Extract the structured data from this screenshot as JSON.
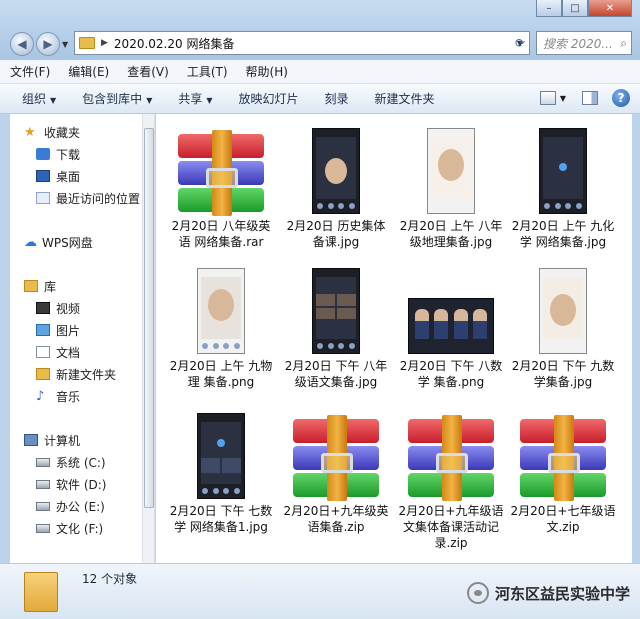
{
  "window": {
    "address_path": "2020.02.20 网络集备",
    "search_placeholder": "搜索 2020...",
    "controls": {
      "minimize": "–",
      "maximize": "□",
      "close": "✕"
    }
  },
  "menu": [
    "文件(F)",
    "编辑(E)",
    "查看(V)",
    "工具(T)",
    "帮助(H)"
  ],
  "commands": [
    {
      "label": "组织",
      "has_dropdown": true
    },
    {
      "label": "包含到库中",
      "has_dropdown": true
    },
    {
      "label": "共享",
      "has_dropdown": true
    },
    {
      "label": "放映幻灯片",
      "has_dropdown": false
    },
    {
      "label": "刻录",
      "has_dropdown": false
    },
    {
      "label": "新建文件夹",
      "has_dropdown": false
    }
  ],
  "nav": {
    "favorites": {
      "label": "收藏夹",
      "items": [
        "下载",
        "桌面",
        "最近访问的位置"
      ]
    },
    "wps": "WPS网盘",
    "library": {
      "label": "库",
      "items": [
        "视频",
        "图片",
        "文档",
        "新建文件夹",
        "音乐"
      ]
    },
    "computer": {
      "label": "计算机",
      "items": [
        "系统 (C:)",
        "软件 (D:)",
        "办公 (E:)",
        "文化 (F:)"
      ]
    }
  },
  "files": [
    {
      "name": "2月20日 八年级英语 网络集备.rar",
      "type": "rar"
    },
    {
      "name": "2月20日 历史集体备课.jpg",
      "type": "phone-dark"
    },
    {
      "name": "2月20日 上午 八年级地理集备.jpg",
      "type": "phone-light"
    },
    {
      "name": "2月20日 上午 九化学 网络集备.jpg",
      "type": "phone-dot"
    },
    {
      "name": "2月20日 上午 九物理 集备.png",
      "type": "phone-light"
    },
    {
      "name": "2月20日 下午 八年级语文集备.jpg",
      "type": "phone-grid"
    },
    {
      "name": "2月20日 下午 八数学 集备.png",
      "type": "wide"
    },
    {
      "name": "2月20日 下午 九数学集备.jpg",
      "type": "phone-light"
    },
    {
      "name": "2月20日 下午 七数学 网络集备1.jpg",
      "type": "phone-dot"
    },
    {
      "name": "2月20日+九年级英语集备.zip",
      "type": "rar"
    },
    {
      "name": "2月20日+九年级语文集体备课活动记录.zip",
      "type": "rar"
    },
    {
      "name": "2月20日+七年级语文.zip",
      "type": "rar"
    }
  ],
  "status": {
    "count": "12 个对象"
  },
  "watermark": "河东区益民实验中学"
}
